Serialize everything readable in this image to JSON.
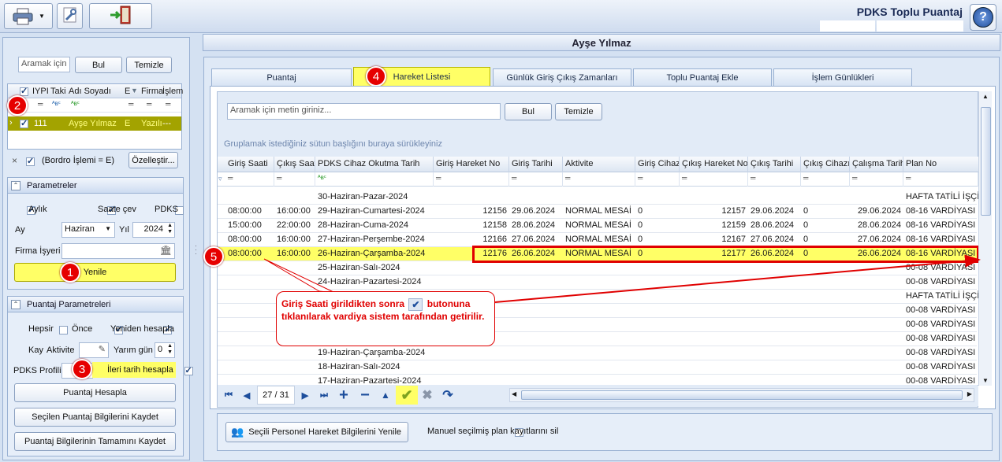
{
  "title": "PDKS Toplu Puantaj",
  "person_name": "Ayşe Yılmaz",
  "toolbar": {
    "printer": "printer-icon",
    "settings": "wrench-icon",
    "exit": "exit-door-icon",
    "help": "help-icon"
  },
  "left": {
    "search_placeholder": "Aramak için m",
    "find_label": "Bul",
    "clear_label": "Temizle",
    "grid_headers": [
      "IYPI",
      "Taki",
      "Adı Soyadı",
      "E",
      "Firma",
      "İşlem"
    ],
    "grid_row": [
      "111",
      "",
      "Ayşe Yılmaz",
      "E",
      "Yazılı",
      "---"
    ],
    "filter_text": "(Bordro İşlemi = E)",
    "customize_label": "Özelleştir...",
    "params_title": "Parametreler",
    "aylik_label": "Aylık",
    "saate_label": "Saate çev",
    "pdks_label": "PDKS",
    "ay_label": "Ay",
    "ay_value": "Haziran",
    "yil_label": "Yıl",
    "yil_value": "2024",
    "firma_label": "Firma İşyeri",
    "refresh_label": "Yenile",
    "puantaj_params_title": "Puantaj Parametreleri",
    "hepsi_label": "Hepsir",
    "once_label": "Önce",
    "yeniden_label": "Yeniden hesapla",
    "kay_label": "Kay",
    "aktivite_label": "Aktivite",
    "yarim_label": "Yarım gün",
    "yarim_value": "0",
    "pdks_profil_label": "PDKS Profili",
    "ileri_label": "İleri tarih hesapla",
    "calc_label": "Puantaj Hesapla",
    "save_selected_label": "Seçilen Puantaj Bilgilerini Kaydet",
    "save_all_label": "Puantaj Bilgilerinin Tamamını Kaydet"
  },
  "tabs": [
    "Puantaj",
    "Hareket Listesi",
    "Günlük Giriş Çıkış Zamanları",
    "Toplu Puantaj Ekle",
    "İşlem Günlükleri"
  ],
  "main": {
    "search_placeholder": "Aramak için metin giriniz...",
    "find_label": "Bul",
    "clear_label": "Temizle",
    "group_hint": "Gruplamak istediğiniz sütun başlığını buraya sürükleyiniz",
    "columns": [
      "Giriş Saati",
      "Çıkış Saati",
      "PDKS Cihaz Okutma Tarih",
      "Giriş Hareket No",
      "Giriş Tarihi",
      "Aktivite",
      "Giriş Cihazı",
      "Çıkış Hareket No",
      "Çıkış Tarihi",
      "Çıkış Cihazı",
      "Çalışma Tarih",
      "Plan No"
    ],
    "rows": [
      [
        "",
        "",
        "30-Haziran-Pazar-2024",
        "",
        "",
        "",
        "",
        "",
        "",
        "",
        "",
        "HAFTA TATİLİ İŞÇİ"
      ],
      [
        "08:00:00",
        "16:00:00",
        "29-Haziran-Cumartesi-2024",
        "12156",
        "29.06.2024",
        "NORMAL MESAİ",
        "0",
        "12157",
        "29.06.2024",
        "0",
        "29.06.2024",
        "08-16 VARDİYASI"
      ],
      [
        "15:00:00",
        "22:00:00",
        "28-Haziran-Cuma-2024",
        "12158",
        "28.06.2024",
        "NORMAL MESAİ",
        "0",
        "12159",
        "28.06.2024",
        "0",
        "28.06.2024",
        "08-16 VARDİYASI"
      ],
      [
        "08:00:00",
        "16:00:00",
        "27-Haziran-Perşembe-2024",
        "12166",
        "27.06.2024",
        "NORMAL MESAİ",
        "0",
        "12167",
        "27.06.2024",
        "0",
        "27.06.2024",
        "08-16 VARDİYASI"
      ],
      [
        "08:00:00",
        "16:00:00",
        "26-Haziran-Çarşamba-2024",
        "12176",
        "26.06.2024",
        "NORMAL MESAİ",
        "0",
        "12177",
        "26.06.2024",
        "0",
        "26.06.2024",
        "08-16 VARDİYASI"
      ],
      [
        "",
        "",
        "25-Haziran-Salı-2024",
        "",
        "",
        "",
        "",
        "",
        "",
        "",
        "",
        "00-08 VARDİYASI"
      ],
      [
        "",
        "",
        "24-Haziran-Pazartesi-2024",
        "",
        "",
        "",
        "",
        "",
        "",
        "",
        "",
        "00-08 VARDİYASI"
      ],
      [
        "",
        "",
        "",
        "",
        "",
        "",
        "",
        "",
        "",
        "",
        "",
        "HAFTA TATİLİ İŞÇİ"
      ],
      [
        "",
        "",
        "",
        "",
        "",
        "",
        "",
        "",
        "",
        "",
        "",
        "00-08 VARDİYASI"
      ],
      [
        "",
        "",
        "",
        "",
        "",
        "",
        "",
        "",
        "",
        "",
        "",
        "00-08 VARDİYASI"
      ],
      [
        "",
        "",
        "",
        "",
        "",
        "",
        "",
        "",
        "",
        "",
        "",
        "00-08 VARDİYASI"
      ],
      [
        "",
        "",
        "19-Haziran-Çarşamba-2024",
        "",
        "",
        "",
        "",
        "",
        "",
        "",
        "",
        "00-08 VARDİYASI"
      ],
      [
        "",
        "",
        "18-Haziran-Salı-2024",
        "",
        "",
        "",
        "",
        "",
        "",
        "",
        "",
        "00-08 VARDİYASI"
      ],
      [
        "",
        "",
        "17-Haziran-Pazartesi-2024",
        "",
        "",
        "",
        "",
        "",
        "",
        "",
        "",
        "00-08 VARDİYASI"
      ]
    ],
    "page_info": "27 / 31",
    "refresh_selected_label": "Seçili Personel Hareket Bilgilerini Yenile",
    "manual_label": "Manuel seçilmiş plan kayıtlarını sil"
  },
  "callout": {
    "text_before": "Giriş Saati girildikten sonra",
    "text_after": "butonuna tıklanılarak vardiya sistem tarafından getirilir."
  },
  "markers": [
    "1",
    "2",
    "3",
    "4",
    "5"
  ],
  "colors": {
    "highlight": "#ffff66",
    "selected_row": "#a3a300",
    "callout_red": "#e00000",
    "frame": "#d4e1f2"
  }
}
